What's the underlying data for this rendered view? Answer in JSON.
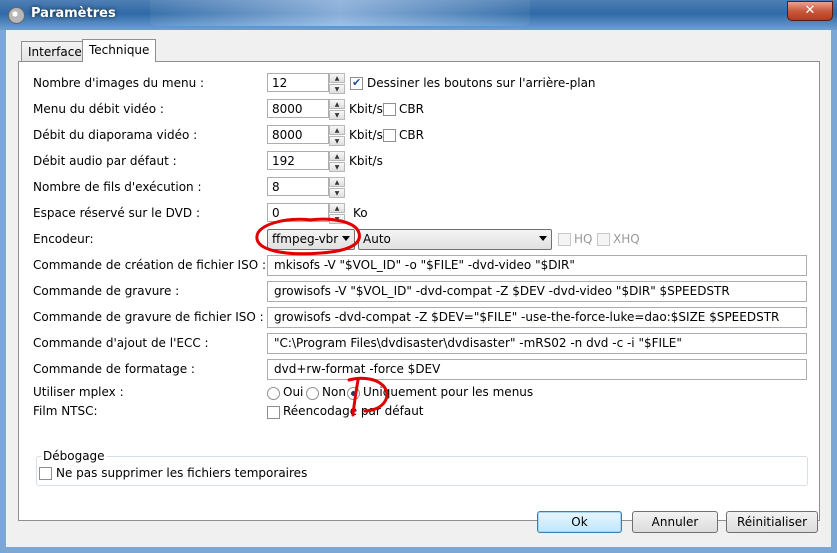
{
  "window": {
    "title": "Paramètres",
    "close_label": "✕"
  },
  "tabs": [
    {
      "label": "Interface",
      "active": false
    },
    {
      "label": "Technique",
      "active": true
    }
  ],
  "fields": {
    "menu_images": {
      "label": "Nombre d'images du menu :",
      "value": "12"
    },
    "draw_buttons": {
      "label": "Dessiner les boutons sur l'arrière-plan",
      "checked": true
    },
    "menu_bitrate": {
      "label": "Menu du débit vidéo :",
      "value": "8000",
      "unit": "Kbit/s",
      "cbr_label": "CBR",
      "cbr_checked": false
    },
    "slideshow_bitrate": {
      "label": "Débit du diaporama vidéo :",
      "value": "8000",
      "unit": "Kbit/s",
      "cbr_label": "CBR",
      "cbr_checked": false
    },
    "audio_bitrate": {
      "label": "Débit audio par défaut :",
      "value": "192",
      "unit": "Kbit/s"
    },
    "threads": {
      "label": "Nombre de fils d'exécution :",
      "value": "8"
    },
    "dvd_reserved": {
      "label": "Espace réservé sur le DVD :",
      "value": "0",
      "unit": "Ko"
    },
    "encoder": {
      "label": "Encodeur:",
      "value": "ffmpeg-vbr",
      "preset": "Auto",
      "hq_label": "HQ",
      "xhq_label": "XHQ"
    },
    "iso_create": {
      "label": "Commande de création de fichier ISO :",
      "value": "mkisofs -V \"$VOL_ID\" -o \"$FILE\" -dvd-video \"$DIR\""
    },
    "burn": {
      "label": "Commande de gravure :",
      "value": "growisofs -V \"$VOL_ID\" -dvd-compat -Z $DEV -dvd-video \"$DIR\" $SPEEDSTR"
    },
    "burn_iso": {
      "label": "Commande de gravure de fichier ISO :",
      "value": "growisofs -dvd-compat -Z $DEV=\"$FILE\" -use-the-force-luke=dao:$SIZE $SPEEDSTR"
    },
    "ecc": {
      "label": "Commande d'ajout de l'ECC :",
      "value": "\"C:\\Program Files\\dvdisaster\\dvdisaster\" -mRS02 -n dvd -c -i \"$FILE\""
    },
    "format": {
      "label": "Commande de formatage :",
      "value": "dvd+rw-format -force $DEV"
    },
    "mplex": {
      "label": "Utiliser mplex :",
      "options": [
        "Oui",
        "Non",
        "Uniquement pour les menus"
      ],
      "selected": "Uniquement pour les menus"
    },
    "ntsc": {
      "label": "Film NTSC:",
      "reencode_label": "Réencodage par défaut",
      "checked": false
    }
  },
  "debug": {
    "group_title": "Débogage",
    "keep_temp_label": "Ne pas supprimer les fichiers temporaires",
    "checked": false
  },
  "buttons": {
    "ok": "Ok",
    "cancel": "Annuler",
    "reset": "Réinitialiser"
  },
  "colors": {
    "annotation": "#e00000",
    "title_blue": "#2f6aa8"
  },
  "icons": {
    "app": "app-icon",
    "spin_up": "spin-up-icon",
    "spin_down": "spin-down-icon",
    "combo_arrow": "chevron-down-icon",
    "close": "close-icon"
  }
}
